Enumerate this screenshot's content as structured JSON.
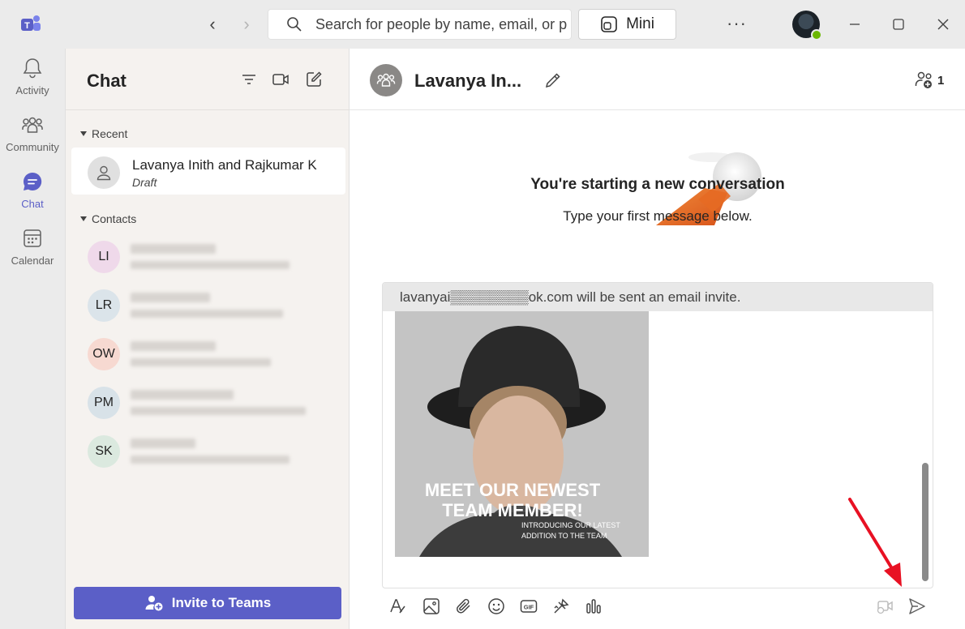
{
  "titlebar": {
    "search_placeholder": "Search for people by name, email, or pl",
    "mini_label": "Mini",
    "more_label": "···"
  },
  "rail": {
    "items": [
      {
        "label": "Activity"
      },
      {
        "label": "Community"
      },
      {
        "label": "Chat"
      },
      {
        "label": "Calendar"
      }
    ]
  },
  "chatlist": {
    "title": "Chat",
    "recent_label": "Recent",
    "contacts_label": "Contacts",
    "recent_item": {
      "name": "Lavanya Inith and Rajkumar K",
      "status": "Draft"
    },
    "contacts": [
      {
        "initials": "LI",
        "color": "#efd9ea"
      },
      {
        "initials": "LR",
        "color": "#dbe4ea"
      },
      {
        "initials": "OW",
        "color": "#f7d9d1"
      },
      {
        "initials": "PM",
        "color": "#d8e2e8"
      },
      {
        "initials": "SK",
        "color": "#dbe9df"
      }
    ],
    "invite_label": "Invite to Teams"
  },
  "main": {
    "title": "Lavanya In...",
    "participant_count": "1",
    "welcome_title": "You're starting a new conversation",
    "welcome_sub": "Type your first message below.",
    "invite_note": "lavanyai▒▒▒▒▒▒▒▒ok.com will be sent an email invite.",
    "photo": {
      "caption_line1": "MEET OUR NEWEST",
      "caption_line2": "TEAM MEMBER!",
      "sub_line1": "INTRODUCING OUR LATEST",
      "sub_line2": "ADDITION TO THE TEAM"
    }
  },
  "colors": {
    "accent": "#5b5fc7",
    "arrow": "#e81123"
  }
}
